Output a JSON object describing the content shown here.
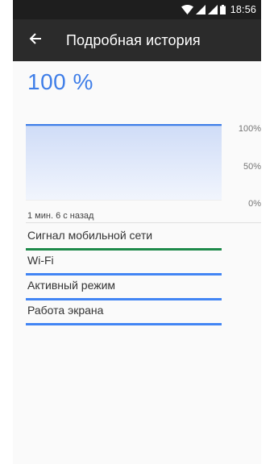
{
  "status_bar": {
    "time": "18:56",
    "icons": [
      "wifi-icon",
      "signal-icon",
      "signal-icon-2",
      "battery-icon"
    ]
  },
  "app_bar": {
    "back_icon": "arrow-back-icon",
    "title": "Подробная история"
  },
  "battery": {
    "level_text": "100 %"
  },
  "graph": {
    "y_labels": [
      "100%",
      "50%",
      "0%"
    ],
    "timestamp": "1 мин. 6 с назад"
  },
  "chart_data": {
    "type": "area",
    "x": [
      0,
      1
    ],
    "series": [
      {
        "values": [
          100,
          100
        ]
      }
    ],
    "ylim": [
      0,
      100
    ],
    "y_ticks": [
      "100%",
      "50%",
      "0%"
    ],
    "grid": true
  },
  "states": [
    {
      "label": "Сигнал мобильной сети",
      "color": "#1e8a4a",
      "fill": 1.0
    },
    {
      "label": "Wi-Fi",
      "color": "#4285f4",
      "fill": 1.0
    },
    {
      "label": "Активный режим",
      "color": "#4285f4",
      "fill": 1.0
    },
    {
      "label": "Работа экрана",
      "color": "#4285f4",
      "fill": 1.0
    }
  ],
  "colors": {
    "accent": "#3f7ee8",
    "status_bar": "#1e1e1e",
    "app_bar": "#2b2b2b"
  }
}
